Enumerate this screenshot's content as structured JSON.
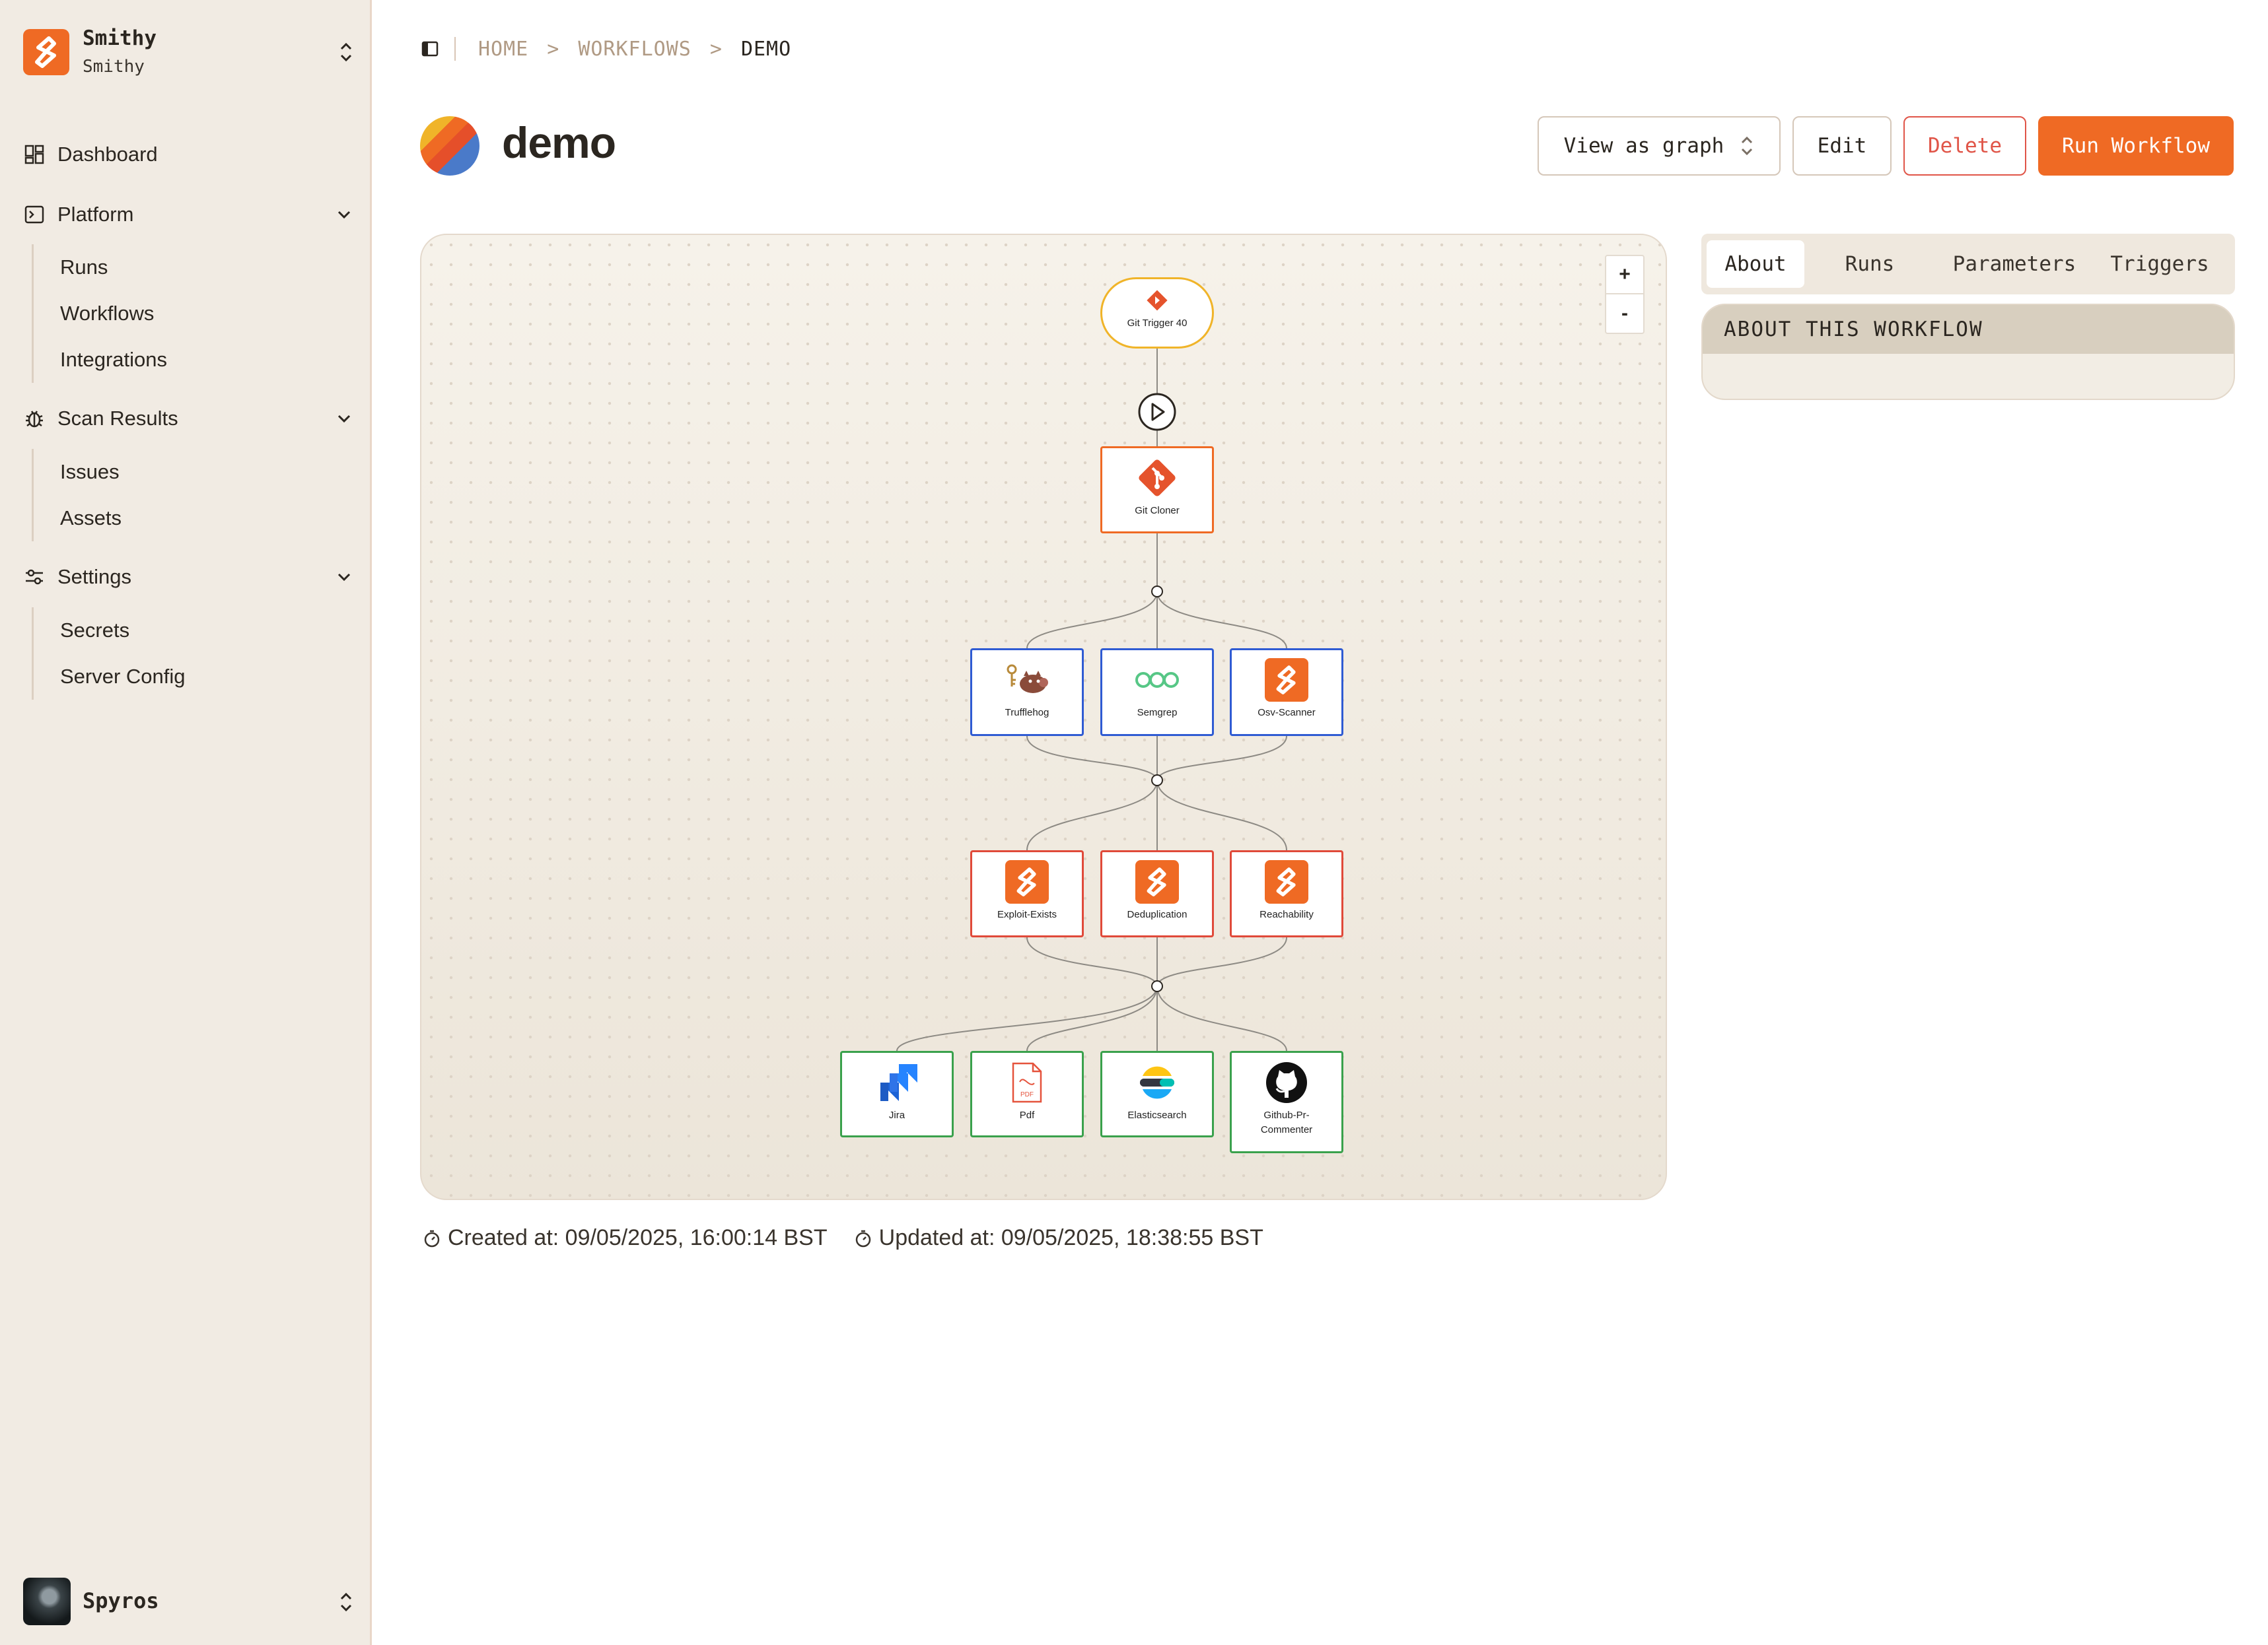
{
  "team": {
    "name": "Smithy",
    "subtitle": "Smithy"
  },
  "sidebar": {
    "dashboard": "Dashboard",
    "platform": {
      "label": "Platform",
      "items": [
        "Runs",
        "Workflows",
        "Integrations"
      ]
    },
    "scan_results": {
      "label": "Scan Results",
      "items": [
        "Issues",
        "Assets"
      ]
    },
    "settings": {
      "label": "Settings",
      "items": [
        "Secrets",
        "Server Config"
      ]
    }
  },
  "user": {
    "name": "Spyros"
  },
  "breadcrumb": {
    "home": "HOME",
    "workflows": "WORKFLOWS",
    "current": "DEMO"
  },
  "workflow": {
    "title": "demo"
  },
  "actions": {
    "view_as": "View as graph",
    "edit": "Edit",
    "delete": "Delete",
    "run": "Run Workflow"
  },
  "zoom": {
    "in": "+",
    "out": "-"
  },
  "graph": {
    "trigger": "Git Trigger 40",
    "cloner": "Git Cloner",
    "scanners": [
      "Trufflehog",
      "Semgrep",
      "Osv-Scanner"
    ],
    "enrichers": [
      "Exploit-Exists",
      "Deduplication",
      "Reachability"
    ],
    "reporters": [
      "Jira",
      "Pdf",
      "Elasticsearch",
      "Github-Pr-\nCommenter"
    ]
  },
  "meta": {
    "created": "Created at: 09/05/2025, 16:00:14 BST",
    "updated": "Updated at: 09/05/2025, 18:38:55 BST"
  },
  "tabs": [
    "About",
    "Runs",
    "Parameters",
    "Triggers"
  ],
  "about": {
    "heading": "ABOUT THIS WORKFLOW"
  },
  "colors": {
    "accent": "#ef6a24",
    "danger": "#e05548",
    "scanner": "#2f5bd3",
    "enricher": "#e04a3a",
    "reporter": "#3aa14c",
    "trigger": "#f0b429"
  }
}
